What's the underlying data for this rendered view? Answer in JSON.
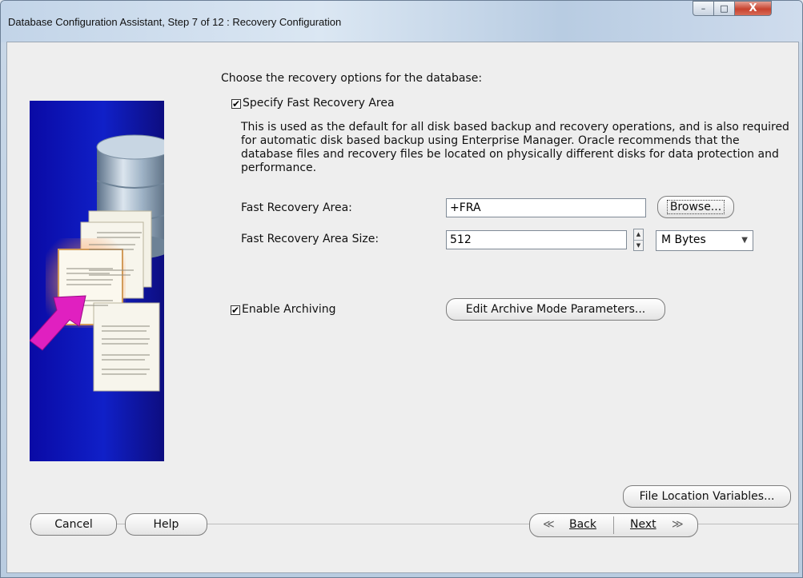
{
  "window": {
    "title": "Database Configuration Assistant, Step 7 of 12 : Recovery Configuration",
    "controls": {
      "minimize": "–",
      "maximize": "□",
      "close": "X"
    }
  },
  "main": {
    "prompt": "Choose the recovery options for the database:",
    "fra_checkbox": {
      "label": "Specify Fast Recovery Area",
      "checked": true,
      "mark": "✔"
    },
    "description": "This is used as the default for all disk based backup and recovery operations, and is also required for automatic disk based backup using Enterprise Manager. Oracle recommends that the database files and recovery files be located on physically different disks for data protection and performance.",
    "fra": {
      "label": "Fast Recovery Area:",
      "value": "+FRA",
      "browse_label": "Browse..."
    },
    "fra_size": {
      "label": "Fast Recovery Area Size:",
      "value": "512",
      "unit": "M Bytes",
      "up": "▲",
      "down": "▼",
      "arrow": "▼"
    },
    "archiving_checkbox": {
      "label": "Enable Archiving",
      "checked": true,
      "mark": "✔"
    },
    "archive_params_label": "Edit Archive Mode Parameters..."
  },
  "footer": {
    "file_location_label": "File Location Variables...",
    "cancel_label": "Cancel",
    "help_label": "Help",
    "back_label": "Back",
    "back_glyph": "≪",
    "next_label": "Next",
    "next_glyph": "≫"
  },
  "colors": {
    "picture_bg": "#1020c8",
    "accent_arrow": "#e020c0"
  }
}
